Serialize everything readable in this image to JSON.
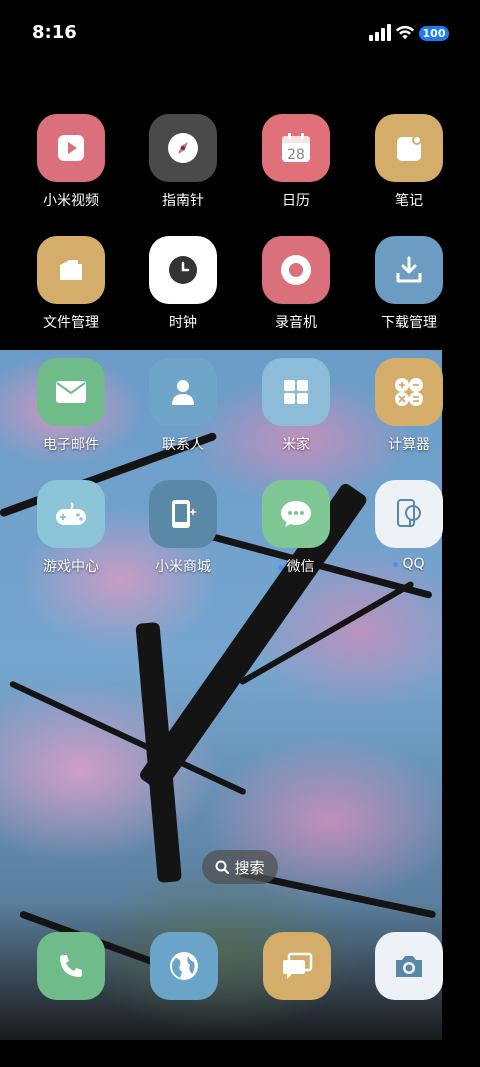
{
  "status_bar": {
    "time": "8:16",
    "battery": "100"
  },
  "apps": [
    {
      "id": "mi-video",
      "label": "小米视频",
      "color": "#d9707b",
      "icon": "video-play-icon"
    },
    {
      "id": "compass",
      "label": "指南针",
      "color": "#4a4a4a",
      "icon": "compass-icon"
    },
    {
      "id": "calendar",
      "label": "日历",
      "color": "#e0707a",
      "icon": "calendar-icon",
      "badge": "28"
    },
    {
      "id": "notes",
      "label": "笔记",
      "color": "#d4ad6a",
      "icon": "note-icon"
    },
    {
      "id": "files",
      "label": "文件管理",
      "color": "#d4ad6a",
      "icon": "folder-icon"
    },
    {
      "id": "clock",
      "label": "时钟",
      "color": "#ffffff",
      "icon": "clock-icon"
    },
    {
      "id": "recorder",
      "label": "录音机",
      "color": "#d9707b",
      "icon": "record-icon"
    },
    {
      "id": "downloads",
      "label": "下载管理",
      "color": "#6c9cc1",
      "icon": "download-icon"
    },
    {
      "id": "email",
      "label": "电子邮件",
      "color": "#6fbb8a",
      "icon": "mail-icon"
    },
    {
      "id": "contacts",
      "label": "联系人",
      "color": "#6ea5c9",
      "icon": "person-icon"
    },
    {
      "id": "mijia",
      "label": "米家",
      "color": "#8dbcd8",
      "icon": "grid-tiles-icon"
    },
    {
      "id": "calculator",
      "label": "计算器",
      "color": "#d4ad6a",
      "icon": "calculator-icon"
    },
    {
      "id": "game-center",
      "label": "游戏中心",
      "color": "#8cc4d8",
      "icon": "gamepad-icon"
    },
    {
      "id": "mi-store",
      "label": "小米商城",
      "color": "#5a89a8",
      "icon": "store-phone-icon"
    },
    {
      "id": "wechat",
      "label": "微信",
      "color": "#7fc795",
      "icon": "wechat-icon",
      "dot": true
    },
    {
      "id": "qq",
      "label": "QQ",
      "color": "#eef2f6",
      "icon": "qq-icon",
      "dot": true
    }
  ],
  "search": {
    "label": "搜索"
  },
  "dock": [
    {
      "id": "phone",
      "color": "#6fbb8a",
      "icon": "phone-icon"
    },
    {
      "id": "browser",
      "color": "#6aa5c9",
      "icon": "globe-icon"
    },
    {
      "id": "messages",
      "color": "#d4ad6a",
      "icon": "messages-icon"
    },
    {
      "id": "camera",
      "color": "#eef2f6",
      "icon": "camera-icon"
    }
  ]
}
